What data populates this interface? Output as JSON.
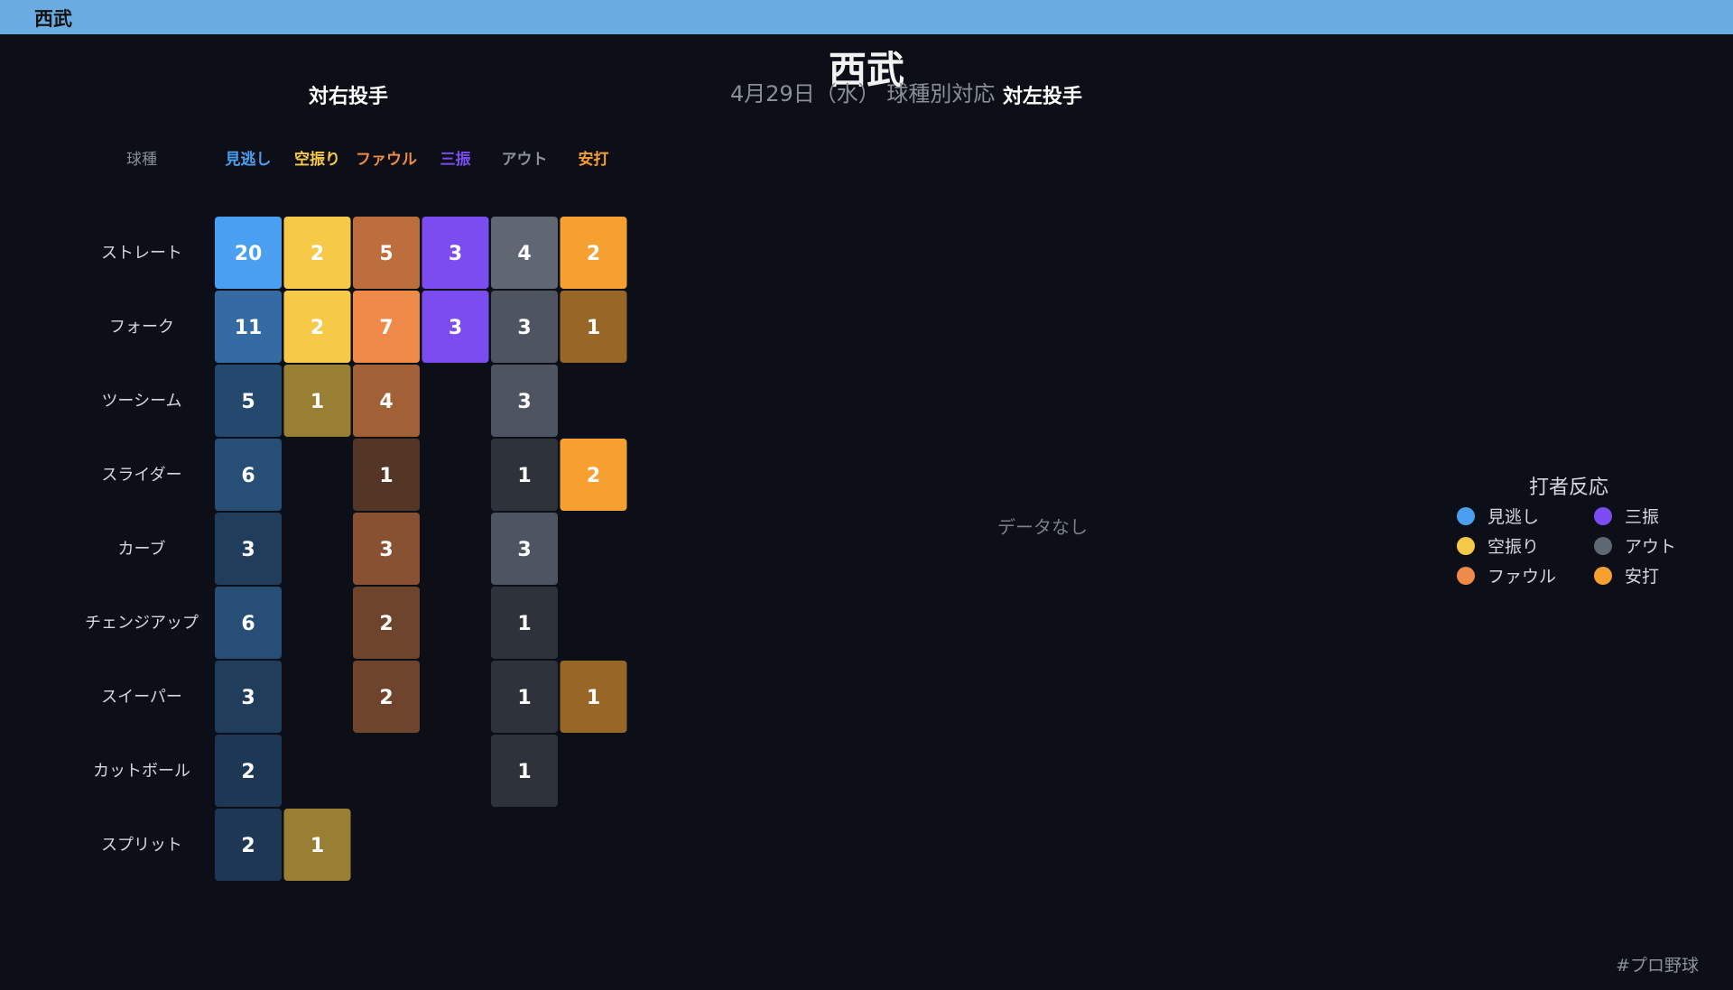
{
  "header": {
    "team": "西武"
  },
  "title": "西武",
  "subtitle": "4月29日（水） 球種別対応",
  "panels": {
    "right": {
      "title": "対右投手"
    },
    "left": {
      "title": "対左投手",
      "empty_text": "データなし"
    }
  },
  "legend": {
    "title": "打者反応",
    "items": [
      {
        "label": "見逃し",
        "color": "#4a9ff0"
      },
      {
        "label": "三振",
        "color": "#7b4cf0"
      },
      {
        "label": "空振り",
        "color": "#f7c948"
      },
      {
        "label": "アウト",
        "color": "#5f6772"
      },
      {
        "label": "ファウル",
        "color": "#f08a48"
      },
      {
        "label": "安打",
        "color": "#f5a030"
      }
    ]
  },
  "footer": {
    "hashtag": "#プロ野球"
  },
  "chart_data": {
    "type": "heatmap",
    "title": "対右投手",
    "row_header": "球種",
    "columns": [
      {
        "label": "見逃し",
        "color": "#4a9ff0",
        "max": 20
      },
      {
        "label": "空振り",
        "color": "#f7c948",
        "max": 2
      },
      {
        "label": "ファウル",
        "color": "#f08a48",
        "max": 7
      },
      {
        "label": "三振",
        "color": "#7b4cf0",
        "max": 3
      },
      {
        "label": "アウト",
        "color": "#5f6772",
        "max": 4
      },
      {
        "label": "安打",
        "color": "#f5a030",
        "max": 2
      }
    ],
    "rows": [
      "ストレート",
      "フォーク",
      "ツーシーム",
      "スライダー",
      "カーブ",
      "チェンジアップ",
      "スイーパー",
      "カットボール",
      "スプリット"
    ],
    "values": [
      [
        20,
        2,
        5,
        3,
        4,
        2
      ],
      [
        11,
        2,
        7,
        3,
        3,
        1
      ],
      [
        5,
        1,
        4,
        null,
        3,
        null
      ],
      [
        6,
        null,
        1,
        null,
        1,
        2
      ],
      [
        3,
        null,
        3,
        null,
        3,
        null
      ],
      [
        6,
        null,
        2,
        null,
        1,
        null
      ],
      [
        3,
        null,
        2,
        null,
        1,
        1
      ],
      [
        2,
        null,
        null,
        null,
        1,
        null
      ],
      [
        2,
        1,
        null,
        null,
        null,
        null
      ]
    ]
  }
}
